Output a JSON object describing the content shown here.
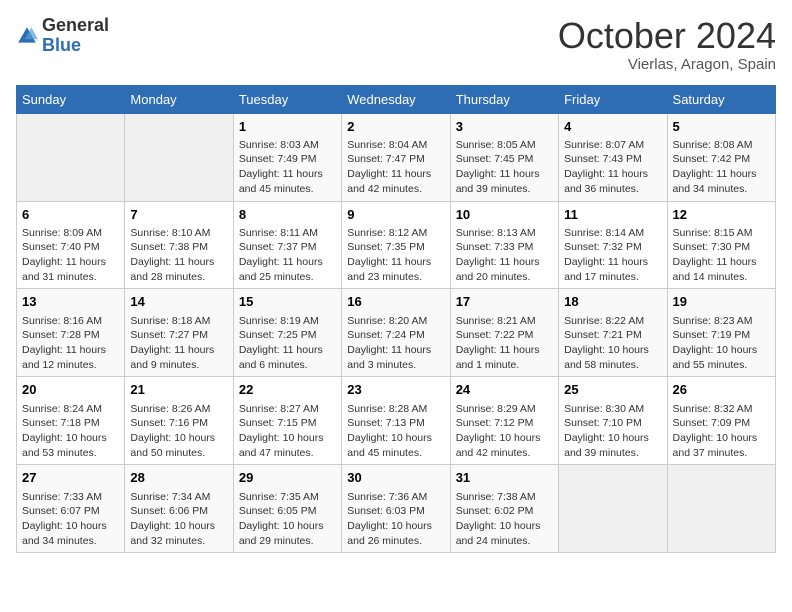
{
  "header": {
    "logo_general": "General",
    "logo_blue": "Blue",
    "title": "October 2024",
    "subtitle": "Vierlas, Aragon, Spain"
  },
  "days_of_week": [
    "Sunday",
    "Monday",
    "Tuesday",
    "Wednesday",
    "Thursday",
    "Friday",
    "Saturday"
  ],
  "weeks": [
    [
      {
        "day": "",
        "info": ""
      },
      {
        "day": "",
        "info": ""
      },
      {
        "day": "1",
        "info": "Sunrise: 8:03 AM\nSunset: 7:49 PM\nDaylight: 11 hours and 45 minutes."
      },
      {
        "day": "2",
        "info": "Sunrise: 8:04 AM\nSunset: 7:47 PM\nDaylight: 11 hours and 42 minutes."
      },
      {
        "day": "3",
        "info": "Sunrise: 8:05 AM\nSunset: 7:45 PM\nDaylight: 11 hours and 39 minutes."
      },
      {
        "day": "4",
        "info": "Sunrise: 8:07 AM\nSunset: 7:43 PM\nDaylight: 11 hours and 36 minutes."
      },
      {
        "day": "5",
        "info": "Sunrise: 8:08 AM\nSunset: 7:42 PM\nDaylight: 11 hours and 34 minutes."
      }
    ],
    [
      {
        "day": "6",
        "info": "Sunrise: 8:09 AM\nSunset: 7:40 PM\nDaylight: 11 hours and 31 minutes."
      },
      {
        "day": "7",
        "info": "Sunrise: 8:10 AM\nSunset: 7:38 PM\nDaylight: 11 hours and 28 minutes."
      },
      {
        "day": "8",
        "info": "Sunrise: 8:11 AM\nSunset: 7:37 PM\nDaylight: 11 hours and 25 minutes."
      },
      {
        "day": "9",
        "info": "Sunrise: 8:12 AM\nSunset: 7:35 PM\nDaylight: 11 hours and 23 minutes."
      },
      {
        "day": "10",
        "info": "Sunrise: 8:13 AM\nSunset: 7:33 PM\nDaylight: 11 hours and 20 minutes."
      },
      {
        "day": "11",
        "info": "Sunrise: 8:14 AM\nSunset: 7:32 PM\nDaylight: 11 hours and 17 minutes."
      },
      {
        "day": "12",
        "info": "Sunrise: 8:15 AM\nSunset: 7:30 PM\nDaylight: 11 hours and 14 minutes."
      }
    ],
    [
      {
        "day": "13",
        "info": "Sunrise: 8:16 AM\nSunset: 7:28 PM\nDaylight: 11 hours and 12 minutes."
      },
      {
        "day": "14",
        "info": "Sunrise: 8:18 AM\nSunset: 7:27 PM\nDaylight: 11 hours and 9 minutes."
      },
      {
        "day": "15",
        "info": "Sunrise: 8:19 AM\nSunset: 7:25 PM\nDaylight: 11 hours and 6 minutes."
      },
      {
        "day": "16",
        "info": "Sunrise: 8:20 AM\nSunset: 7:24 PM\nDaylight: 11 hours and 3 minutes."
      },
      {
        "day": "17",
        "info": "Sunrise: 8:21 AM\nSunset: 7:22 PM\nDaylight: 11 hours and 1 minute."
      },
      {
        "day": "18",
        "info": "Sunrise: 8:22 AM\nSunset: 7:21 PM\nDaylight: 10 hours and 58 minutes."
      },
      {
        "day": "19",
        "info": "Sunrise: 8:23 AM\nSunset: 7:19 PM\nDaylight: 10 hours and 55 minutes."
      }
    ],
    [
      {
        "day": "20",
        "info": "Sunrise: 8:24 AM\nSunset: 7:18 PM\nDaylight: 10 hours and 53 minutes."
      },
      {
        "day": "21",
        "info": "Sunrise: 8:26 AM\nSunset: 7:16 PM\nDaylight: 10 hours and 50 minutes."
      },
      {
        "day": "22",
        "info": "Sunrise: 8:27 AM\nSunset: 7:15 PM\nDaylight: 10 hours and 47 minutes."
      },
      {
        "day": "23",
        "info": "Sunrise: 8:28 AM\nSunset: 7:13 PM\nDaylight: 10 hours and 45 minutes."
      },
      {
        "day": "24",
        "info": "Sunrise: 8:29 AM\nSunset: 7:12 PM\nDaylight: 10 hours and 42 minutes."
      },
      {
        "day": "25",
        "info": "Sunrise: 8:30 AM\nSunset: 7:10 PM\nDaylight: 10 hours and 39 minutes."
      },
      {
        "day": "26",
        "info": "Sunrise: 8:32 AM\nSunset: 7:09 PM\nDaylight: 10 hours and 37 minutes."
      }
    ],
    [
      {
        "day": "27",
        "info": "Sunrise: 7:33 AM\nSunset: 6:07 PM\nDaylight: 10 hours and 34 minutes."
      },
      {
        "day": "28",
        "info": "Sunrise: 7:34 AM\nSunset: 6:06 PM\nDaylight: 10 hours and 32 minutes."
      },
      {
        "day": "29",
        "info": "Sunrise: 7:35 AM\nSunset: 6:05 PM\nDaylight: 10 hours and 29 minutes."
      },
      {
        "day": "30",
        "info": "Sunrise: 7:36 AM\nSunset: 6:03 PM\nDaylight: 10 hours and 26 minutes."
      },
      {
        "day": "31",
        "info": "Sunrise: 7:38 AM\nSunset: 6:02 PM\nDaylight: 10 hours and 24 minutes."
      },
      {
        "day": "",
        "info": ""
      },
      {
        "day": "",
        "info": ""
      }
    ]
  ]
}
